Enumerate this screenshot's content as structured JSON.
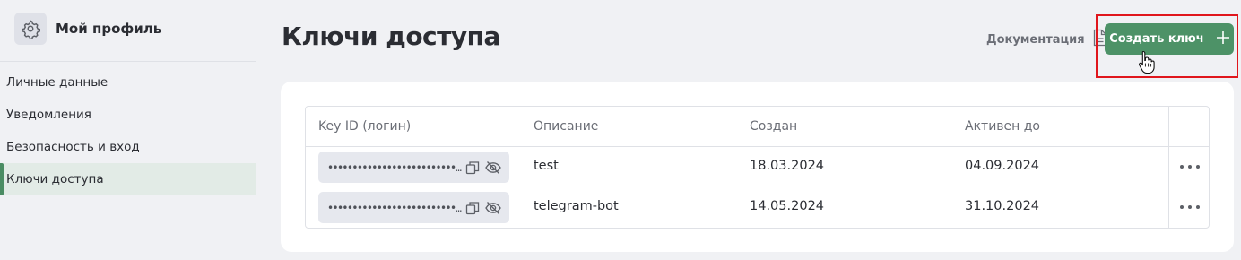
{
  "sidebar": {
    "profile_title": "Мой профиль",
    "profile_icon": "gear-icon",
    "items": [
      {
        "label": "Личные данные",
        "active": false
      },
      {
        "label": "Уведомления",
        "active": false
      },
      {
        "label": "Безопасность и вход",
        "active": false
      },
      {
        "label": "Ключи доступа",
        "active": true
      }
    ]
  },
  "header": {
    "title": "Ключи доступа",
    "doc_label": "Документация",
    "doc_icon": "document-icon",
    "create_label": "Создать ключ",
    "create_icon": "plus-icon"
  },
  "table": {
    "columns": [
      "Key ID (логин)",
      "Описание",
      "Создан",
      "Активен до"
    ],
    "rows": [
      {
        "key_id": "••••••••••••••••••••••••••...",
        "description": "test",
        "created": "18.03.2024",
        "active_until": "04.09.2024"
      },
      {
        "key_id": "••••••••••••••••••••••••••...",
        "description": "telegram-bot",
        "created": "14.05.2024",
        "active_until": "31.10.2024"
      }
    ]
  },
  "colors": {
    "accent": "#4d9267",
    "highlight": "#e0161c",
    "active_nav": "#e2ebe6"
  }
}
